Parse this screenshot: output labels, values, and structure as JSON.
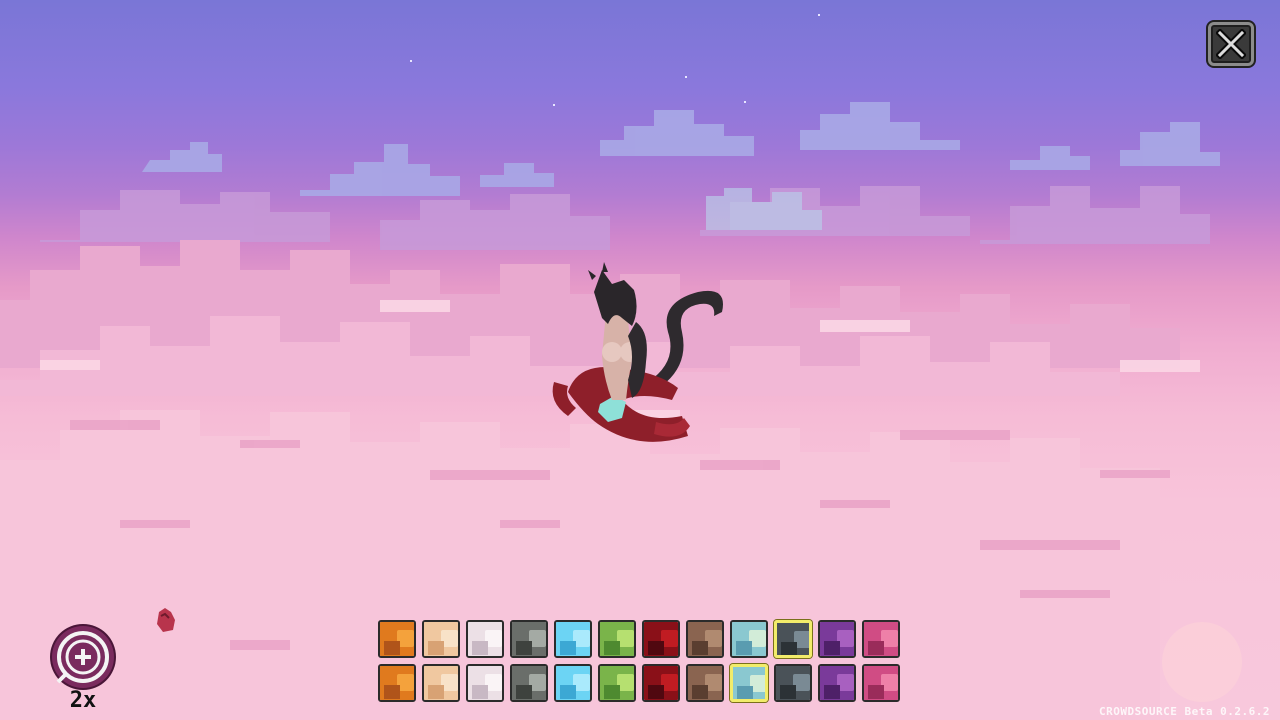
{
  "scene": {
    "sky_top": "#7a76d6",
    "sky_mid": "#cf86cc",
    "cloud_base": "#f8c8dc"
  },
  "toolbar": {
    "close_icon": "close-x-icon",
    "zoom_icon": "zoom-in-plus-icon",
    "zoom_level": "2x"
  },
  "palette": {
    "rows": [
      [
        {
          "name": "orange",
          "base": "#e07a1e",
          "light": "#f4a23c",
          "dark": "#b0541a"
        },
        {
          "name": "peach",
          "base": "#f0c8a0",
          "light": "#f8e2c8",
          "dark": "#d8a274"
        },
        {
          "name": "pearl",
          "base": "#ece0e6",
          "light": "#faf4f6",
          "dark": "#c8b8c4"
        },
        {
          "name": "graphite",
          "base": "#6a6e6a",
          "light": "#a4aaa4",
          "dark": "#3e423e"
        },
        {
          "name": "sky",
          "base": "#6cd4f4",
          "light": "#aaeafc",
          "dark": "#3ca8d4"
        },
        {
          "name": "lime",
          "base": "#7ab44a",
          "light": "#b6e070",
          "dark": "#4e8a30"
        },
        {
          "name": "crimson",
          "base": "#8a1018",
          "light": "#c01c22",
          "dark": "#500810"
        },
        {
          "name": "cocoa",
          "base": "#8a6450",
          "light": "#b08a70",
          "dark": "#5a3e30"
        },
        {
          "name": "seafoam",
          "base": "#8ac8d0",
          "light": "#d2ecd8",
          "dark": "#5a9cb0"
        },
        {
          "name": "slate",
          "base": "#4a5258",
          "light": "#7a8a94",
          "dark": "#2c3236",
          "selected": true
        },
        {
          "name": "violet",
          "base": "#7a3a9a",
          "light": "#a860c0",
          "dark": "#4e2068"
        },
        {
          "name": "rose",
          "base": "#d04c84",
          "light": "#ee80a8",
          "dark": "#9a2c5a"
        }
      ],
      [
        {
          "name": "orange",
          "base": "#e07a1e",
          "light": "#f4a23c",
          "dark": "#b0541a"
        },
        {
          "name": "peach",
          "base": "#f0c8a0",
          "light": "#f8e2c8",
          "dark": "#d8a274"
        },
        {
          "name": "pearl",
          "base": "#ece0e6",
          "light": "#faf4f6",
          "dark": "#c8b8c4"
        },
        {
          "name": "graphite",
          "base": "#6a6e6a",
          "light": "#a4aaa4",
          "dark": "#3e423e"
        },
        {
          "name": "sky",
          "base": "#6cd4f4",
          "light": "#aaeafc",
          "dark": "#3ca8d4"
        },
        {
          "name": "lime",
          "base": "#7ab44a",
          "light": "#b6e070",
          "dark": "#4e8a30"
        },
        {
          "name": "crimson",
          "base": "#8a1018",
          "light": "#c01c22",
          "dark": "#500810"
        },
        {
          "name": "cocoa",
          "base": "#8a6450",
          "light": "#b08a70",
          "dark": "#5a3e30"
        },
        {
          "name": "seafoam",
          "base": "#8ac8d0",
          "light": "#d2ecd8",
          "dark": "#5a9cb0",
          "selected": true
        },
        {
          "name": "slate",
          "base": "#4a5258",
          "light": "#7a8a94",
          "dark": "#2c3236"
        },
        {
          "name": "violet",
          "base": "#7a3a9a",
          "light": "#a860c0",
          "dark": "#4e2068"
        },
        {
          "name": "rose",
          "base": "#d04c84",
          "light": "#ee80a8",
          "dark": "#9a2c5a"
        }
      ]
    ]
  },
  "footer": {
    "version": "CROWDSOURCE Beta 0.2.6.2"
  }
}
